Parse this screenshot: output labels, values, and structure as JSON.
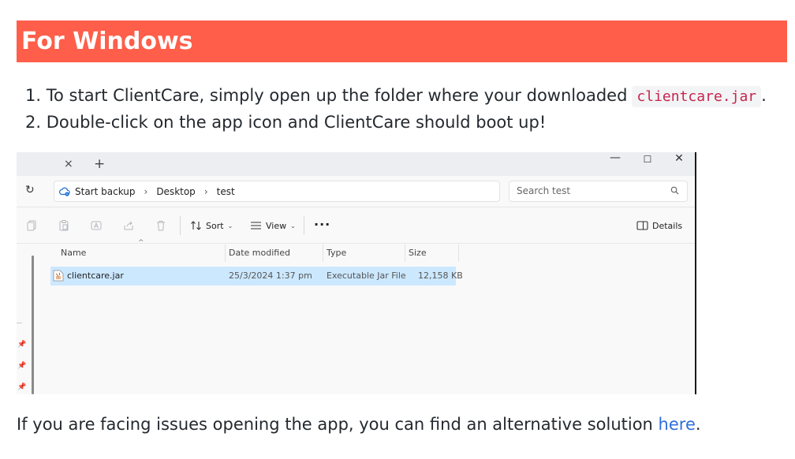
{
  "heading": "For Windows",
  "steps": [
    {
      "num": "1.",
      "text": "To start ClientCare, simply open up the folder where your downloaded",
      "code": "clientcare.jar",
      "after": "."
    },
    {
      "num": "2.",
      "text": "Double-click on the app icon and ClientCare should boot up!"
    }
  ],
  "explorer": {
    "titlebar": {
      "tab_close": "×",
      "tab_new": "+",
      "minimize": "—",
      "maximize": "☐",
      "close": "✕"
    },
    "address": {
      "refresh_icon": "↻",
      "breadcrumbs": [
        "Start backup",
        "Desktop",
        "test"
      ],
      "separator": "›",
      "search_placeholder": "Search test"
    },
    "toolbar": {
      "sort_label": "Sort",
      "view_label": "View",
      "more_label": "···",
      "details_label": "Details"
    },
    "columns": {
      "name": "Name",
      "date": "Date modified",
      "type": "Type",
      "size": "Size"
    },
    "files": [
      {
        "name": "clientcare.jar",
        "date": "25/3/2024 1:37 pm",
        "type": "Executable Jar File",
        "size": "12,158 KB"
      }
    ]
  },
  "footer": {
    "text": "If you are facing issues opening the app, you can find an alternative solution ",
    "link": "here",
    "after": "."
  },
  "colors": {
    "heading_bg": "#ff5e4a",
    "code_text": "#c7254e",
    "link": "#2f6fde",
    "selected_row": "#cce8ff"
  }
}
